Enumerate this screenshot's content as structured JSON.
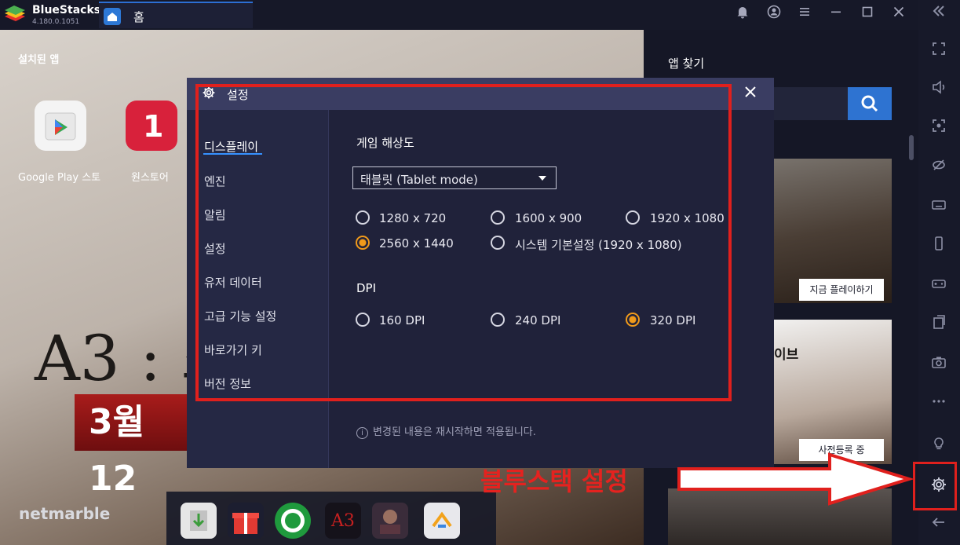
{
  "window": {
    "brand_name": "BlueStacks",
    "brand_version": "4.180.0.1051",
    "home_tab": "홈"
  },
  "home": {
    "installed_label": "설치된 앱",
    "apps": [
      {
        "label": "Google Play 스토",
        "icon": "google-play-icon"
      },
      {
        "label": "원스토어",
        "icon": "onestore-icon"
      }
    ],
    "banner_title": "A3 : 스",
    "banner_date": "3월 12",
    "publisher": "netmarble",
    "dock_icons": [
      "install-apk-icon",
      "gift-icon",
      "bluestacks-cafe-icon",
      "a3-netmarble-icon",
      "webzen-icon",
      "aptoide-icon"
    ]
  },
  "finder": {
    "title": "앱 찾기",
    "cards": [
      {
        "button": "지금 플레이하기"
      },
      {
        "text": "이브",
        "button": "사전등록 중"
      }
    ]
  },
  "dialog": {
    "title": "설정",
    "nav": [
      {
        "label": "디스플레이",
        "active": true
      },
      {
        "label": "엔진"
      },
      {
        "label": "알림"
      },
      {
        "label": "설정"
      },
      {
        "label": "유저 데이터"
      },
      {
        "label": "고급 기능 설정"
      },
      {
        "label": "바로가기 키"
      },
      {
        "label": "버전 정보"
      }
    ],
    "resolution": {
      "title": "게임 해상도",
      "mode": "태블릿 (Tablet mode)",
      "options": [
        {
          "label": "1280 x 720",
          "checked": false
        },
        {
          "label": "1600 x 900",
          "checked": false
        },
        {
          "label": "1920 x 1080",
          "checked": false
        },
        {
          "label": "2560 x 1440",
          "checked": true
        },
        {
          "label": "시스템 기본설정 (1920 x 1080)",
          "checked": false
        }
      ]
    },
    "dpi": {
      "title": "DPI",
      "options": [
        {
          "label": "160 DPI",
          "checked": false
        },
        {
          "label": "240 DPI",
          "checked": false
        },
        {
          "label": "320 DPI",
          "checked": true
        }
      ]
    },
    "footer_note": "변경된 내용은 재시작하면 적용됩니다."
  },
  "annotation": {
    "text": "블루스택 설정",
    "color": "#e0201d"
  },
  "colors": {
    "accent": "#3691ff",
    "radio_checked": "#f09a1b"
  }
}
